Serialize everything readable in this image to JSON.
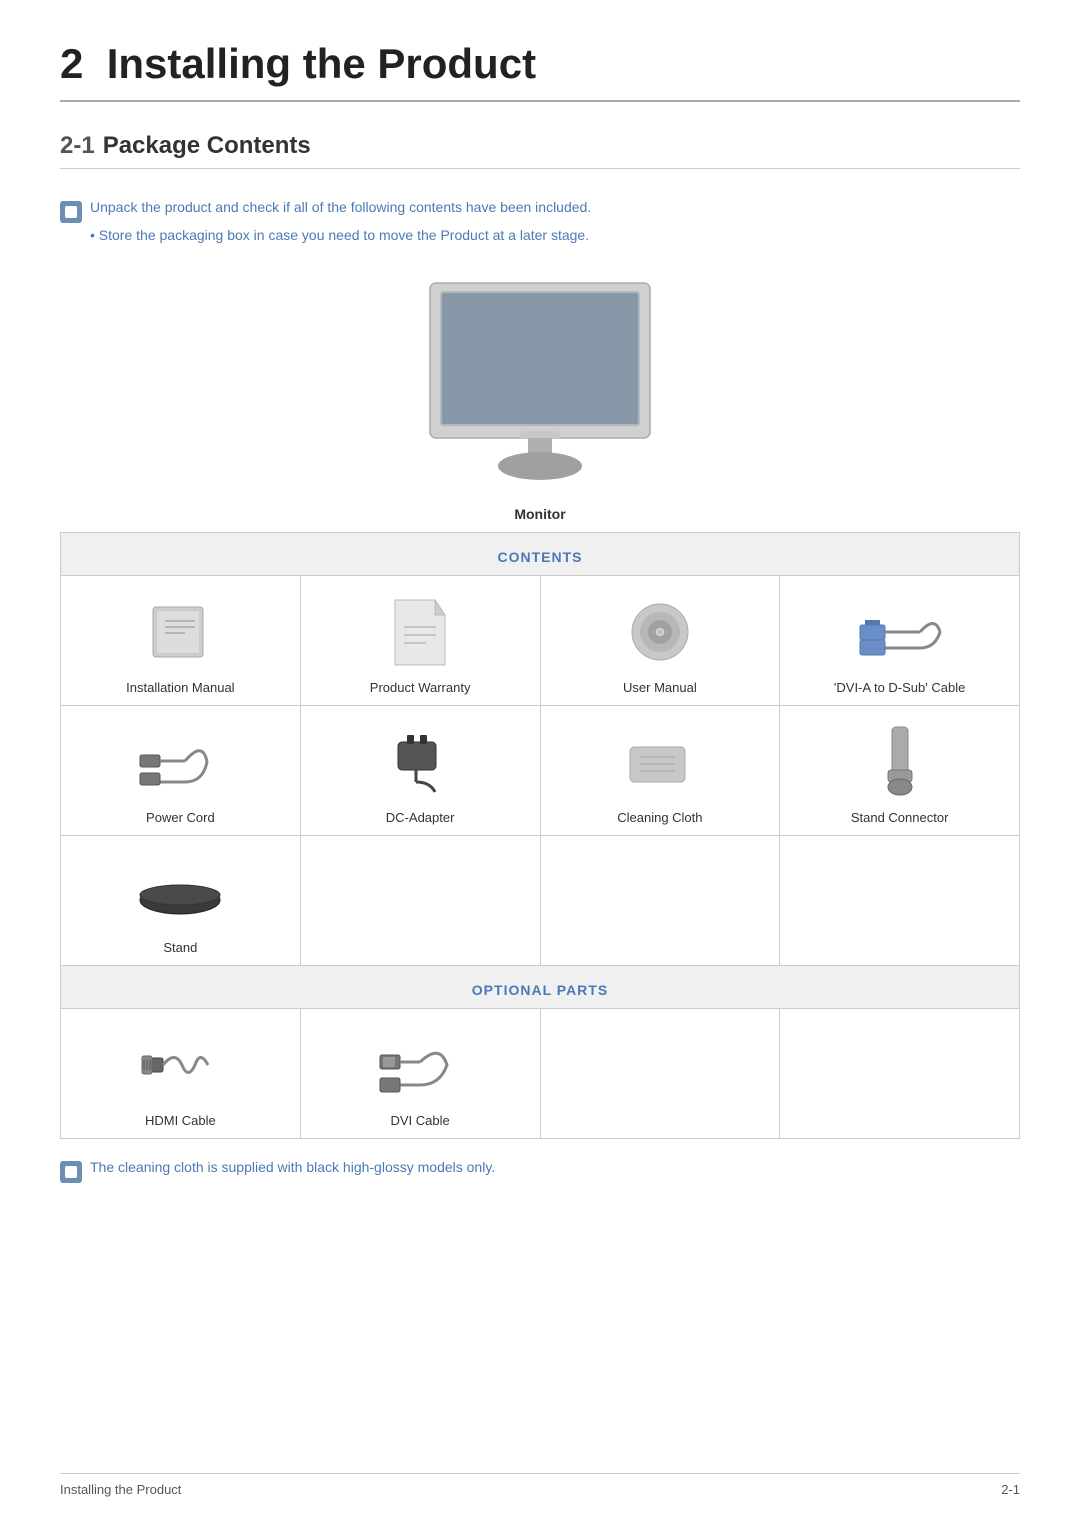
{
  "chapter": {
    "number": "2",
    "title": "Installing the Product"
  },
  "section": {
    "number": "2-1",
    "title": "Package Contents"
  },
  "notes": {
    "note1": "Unpack the product and check if all of the following contents have been included.",
    "note2": "Store the packaging box in case you need to move the Product at a later stage.",
    "note3": "The cleaning cloth is supplied with black high-glossy models only."
  },
  "monitor_label": "Monitor",
  "contents_header": "CONTENTS",
  "optional_header": "OPTIONAL PARTS",
  "items": [
    {
      "label": "Installation Manual"
    },
    {
      "label": "Product Warranty"
    },
    {
      "label": "User Manual"
    },
    {
      "label": "'DVI-A to D-Sub' Cable"
    },
    {
      "label": "Power Cord"
    },
    {
      "label": "DC-Adapter"
    },
    {
      "label": "Cleaning Cloth"
    },
    {
      "label": "Stand Connector"
    },
    {
      "label": "Stand"
    },
    {
      "label": ""
    },
    {
      "label": ""
    },
    {
      "label": ""
    }
  ],
  "optional_items": [
    {
      "label": "HDMI Cable"
    },
    {
      "label": "DVI Cable"
    },
    {
      "label": ""
    },
    {
      "label": ""
    }
  ],
  "footer": {
    "left": "Installing the Product",
    "right": "2-1"
  }
}
